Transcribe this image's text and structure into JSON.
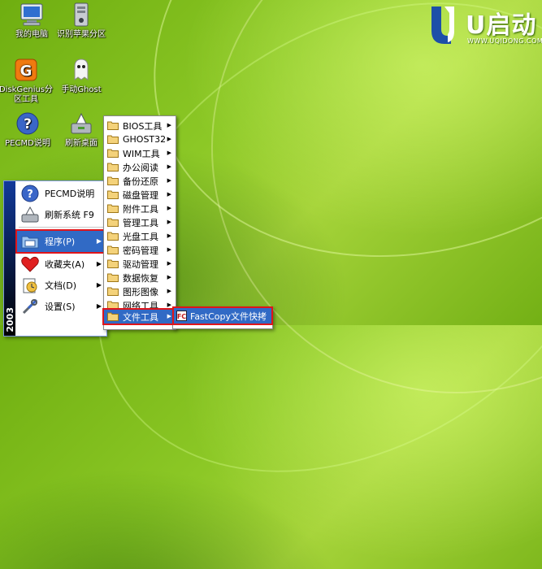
{
  "desktop": {
    "icons": [
      {
        "label": "我的电脑",
        "icon": "computer-icon"
      },
      {
        "label": "识别苹果分区",
        "icon": "disk-partition-icon"
      },
      {
        "label": "DiskGenius分区工具",
        "icon": "diskgenius-icon"
      },
      {
        "label": "手动Ghost",
        "icon": "ghost-icon"
      },
      {
        "label": "PECMD说明",
        "icon": "help-icon"
      },
      {
        "label": "刷新桌面",
        "icon": "refresh-desktop-icon"
      }
    ]
  },
  "logo": {
    "text": "U启动",
    "url": "WWW.UQIDONG.COM"
  },
  "start_menu": {
    "strip_text": "2003",
    "items": [
      {
        "label": "PECMD说明",
        "icon": "help-icon"
      },
      {
        "label": "刷新系统 F9",
        "icon": "refresh-icon"
      },
      {
        "label": "程序(P)",
        "icon": "programs-folder-icon",
        "highlighted": true,
        "has_submenu": true
      },
      {
        "label": "收藏夹(A)",
        "icon": "favorites-icon",
        "has_submenu": true
      },
      {
        "label": "文档(D)",
        "icon": "documents-icon",
        "has_submenu": true
      },
      {
        "label": "设置(S)",
        "icon": "settings-icon",
        "has_submenu": true
      }
    ]
  },
  "programs_menu": {
    "items": [
      {
        "label": "BIOS工具"
      },
      {
        "label": "GHOST32"
      },
      {
        "label": "WIM工具"
      },
      {
        "label": "办公阅读"
      },
      {
        "label": "备份还原"
      },
      {
        "label": "磁盘管理"
      },
      {
        "label": "附件工具"
      },
      {
        "label": "管理工具"
      },
      {
        "label": "光盘工具"
      },
      {
        "label": "密码管理"
      },
      {
        "label": "驱动管理"
      },
      {
        "label": "数据恢复"
      },
      {
        "label": "图形图像"
      },
      {
        "label": "网络工具"
      },
      {
        "label": "文件工具",
        "highlighted": true
      }
    ]
  },
  "file_tools_menu": {
    "items": [
      {
        "label": "FastCopy文件快拷",
        "icon": "fastcopy-icon",
        "highlighted": true
      }
    ]
  },
  "colors": {
    "highlight": "#316ac5",
    "outline": "#e0141a"
  }
}
